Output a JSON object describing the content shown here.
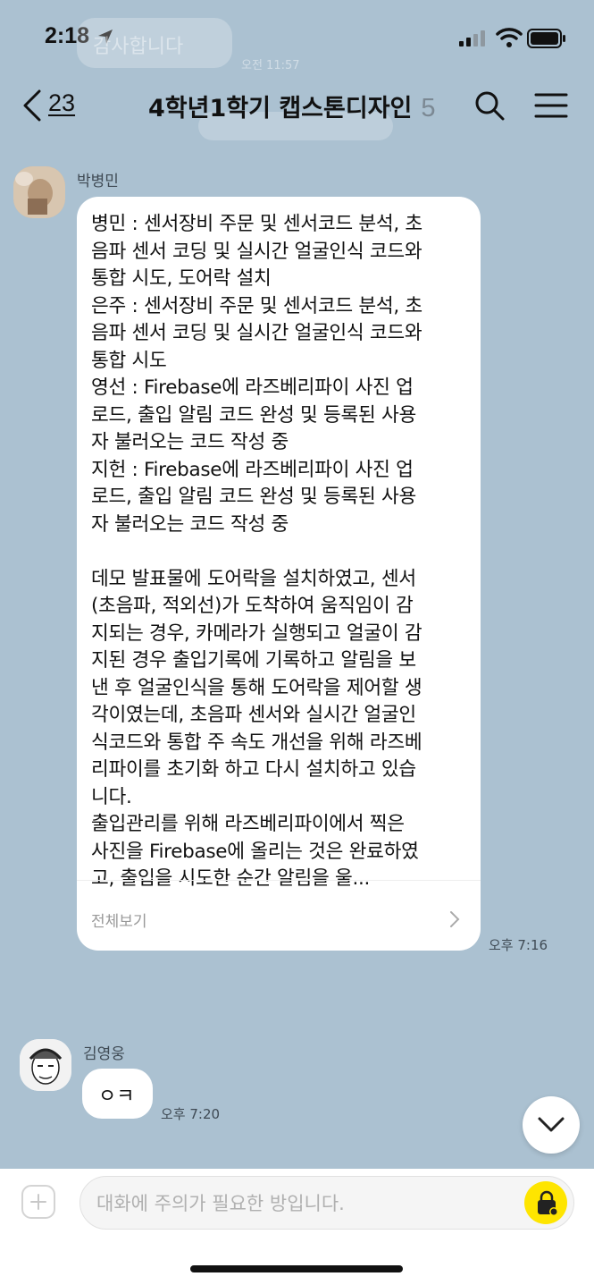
{
  "status_bar": {
    "time": "2:18"
  },
  "background_ghost": {
    "message": "감사합니다",
    "time": "오전 11:57"
  },
  "header": {
    "back_count": "23",
    "title": "4학년1학기 캡스톤디자인",
    "member_count": "5"
  },
  "messages": [
    {
      "sender": "박병민",
      "lines": [
        "병민 : 센서장비 주문 및 센서코드 분석, 초",
        "음파 센서 코딩 및 실시간 얼굴인식 코드와",
        "통합 시도, 도어락 설치",
        "은주 : 센서장비 주문 및 센서코드 분석, 초",
        "음파 센서 코딩 및 실시간 얼굴인식 코드와",
        "통합 시도",
        "영선 : Firebase에 라즈베리파이 사진 업",
        "로드, 출입 알림 코드 완성 및 등록된 사용",
        "자 불러오는 코드 작성 중",
        "지헌 : Firebase에 라즈베리파이 사진 업",
        "로드, 출입 알림 코드 완성 및 등록된 사용",
        "자 불러오는 코드 작성 중",
        "",
        "데모 발표물에 도어락을 설치하였고, 센서",
        "(초음파, 적외선)가 도착하여 움직임이 감",
        "지되는 경우, 카메라가 실행되고 얼굴이 감",
        "지된 경우 출입기록에 기록하고 알림을 보",
        "낸 후 얼굴인식을 통해 도어락을 제어할 생",
        "각이였는데, 초음파 센서와 실시간 얼굴인",
        "식코드와 통합 주 속도 개선을 위해 라즈베",
        "리파이를 초기화 하고 다시 설치하고 있습",
        "니다.",
        "출입관리를 위해 라즈베리파이에서 찍은",
        "사진을 Firebase에 올리는 것은 완료하였",
        "고, 출입을 시도한 순간 알림을 울..."
      ],
      "see_more": "전체보기",
      "time": "오후 7:16"
    },
    {
      "sender": "김영웅",
      "text": "ㅇㅋ",
      "time": "오후 7:20"
    }
  ],
  "input": {
    "placeholder": "대화에 주의가 필요한 방입니다."
  },
  "colors": {
    "chat_bg": "#abc1d1",
    "bubble": "#ffffff",
    "send_button": "#fee500"
  },
  "icons": [
    "location-arrow-icon",
    "signal-icon",
    "wifi-icon",
    "battery-icon",
    "back-chevron-icon",
    "search-icon",
    "hamburger-menu-icon",
    "chevron-right-icon",
    "chevron-down-icon",
    "plus-icon",
    "send-lock-icon"
  ]
}
